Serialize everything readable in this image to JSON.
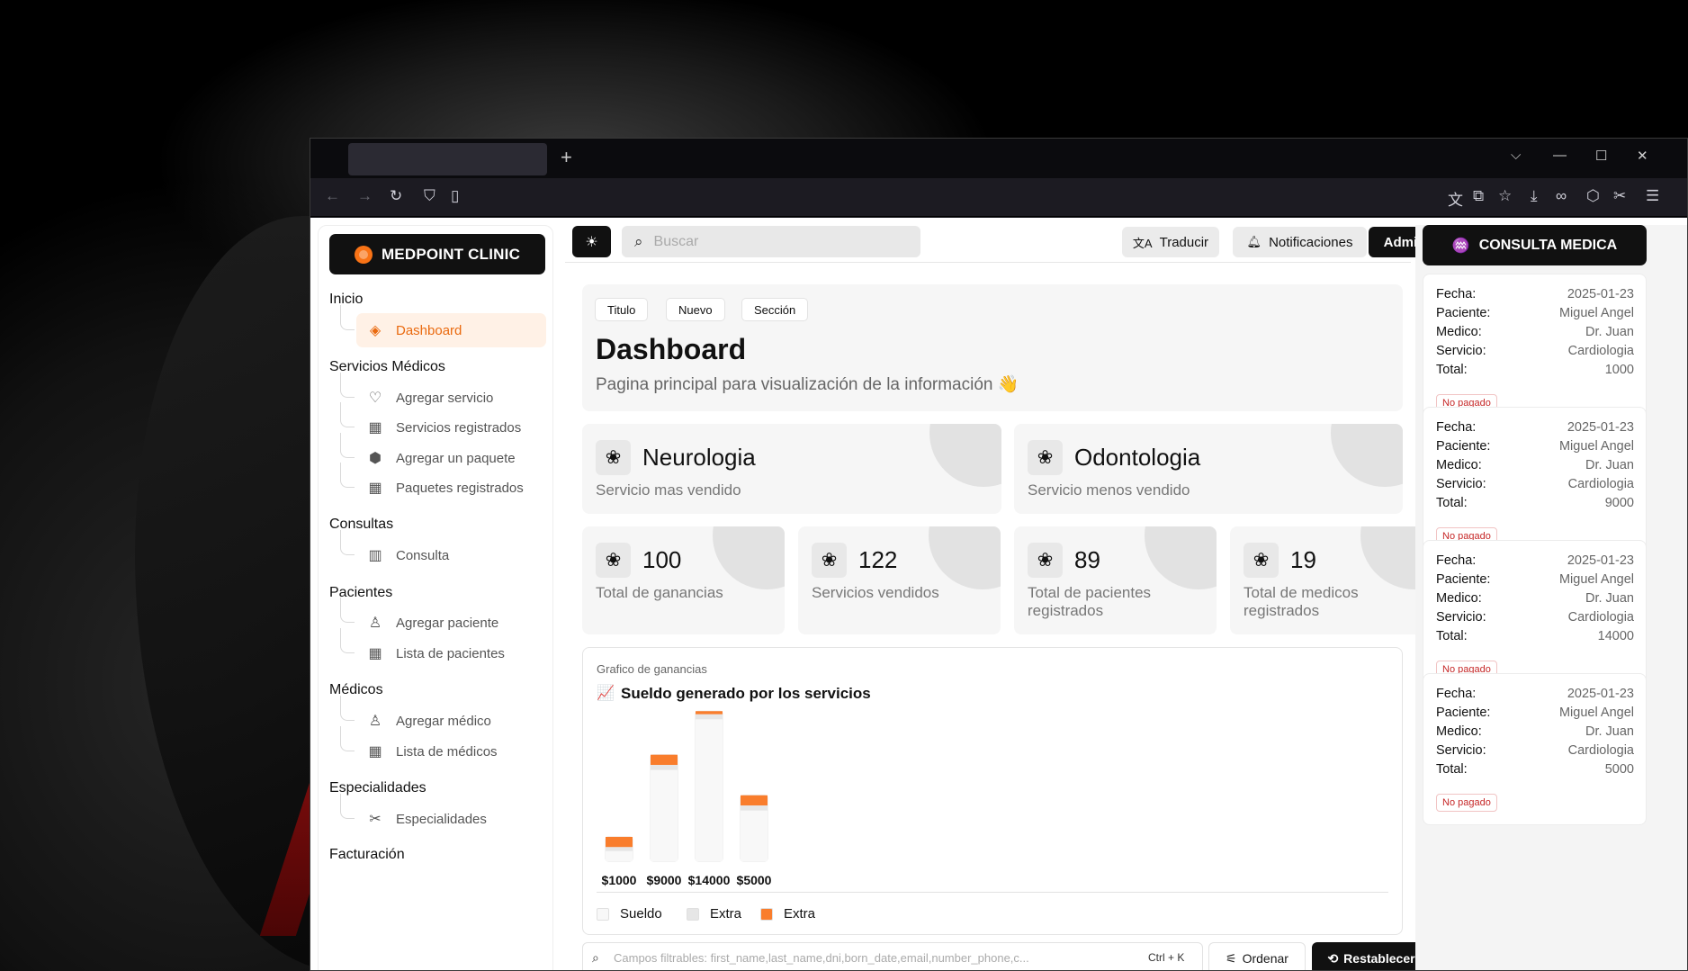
{
  "browser": {
    "new_tab_glyph": "+",
    "tab_list_glyph": "⌵",
    "minimize_glyph": "—",
    "maximize_glyph": "☐",
    "close_glyph": "✕"
  },
  "sidebar": {
    "brand": "MEDPOINT CLINIC",
    "sections": [
      {
        "title": "Inicio",
        "items": [
          {
            "label": "Dashboard",
            "icon": "layers-icon",
            "glyph": "◈",
            "active": true
          }
        ]
      },
      {
        "title": "Servicios Médicos",
        "items": [
          {
            "label": "Agregar servicio",
            "icon": "heart-hand-icon",
            "glyph": "♡"
          },
          {
            "label": "Servicios registrados",
            "icon": "grid-icon",
            "glyph": "▦"
          },
          {
            "label": "Agregar un paquete",
            "icon": "package-icon",
            "glyph": "⬢"
          },
          {
            "label": "Paquetes registrados",
            "icon": "grid-icon",
            "glyph": "▦"
          }
        ]
      },
      {
        "title": "Consultas",
        "items": [
          {
            "label": "Consulta",
            "icon": "building-icon",
            "glyph": "▥"
          }
        ]
      },
      {
        "title": "Pacientes",
        "items": [
          {
            "label": "Agregar paciente",
            "icon": "user-icon",
            "glyph": "♙"
          },
          {
            "label": "Lista de pacientes",
            "icon": "grid-icon",
            "glyph": "▦"
          }
        ]
      },
      {
        "title": "Médicos",
        "items": [
          {
            "label": "Agregar médico",
            "icon": "user-plus-icon",
            "glyph": "♙"
          },
          {
            "label": "Lista de médicos",
            "icon": "grid-icon",
            "glyph": "▦"
          }
        ]
      },
      {
        "title": "Especialidades",
        "items": [
          {
            "label": "Especialidades",
            "icon": "scissors-icon",
            "glyph": "✂"
          }
        ]
      },
      {
        "title": "Facturación",
        "items": []
      }
    ]
  },
  "topbar": {
    "search_placeholder": "Buscar",
    "translate_label": "Traducir",
    "notifications_label": "Notificaciones",
    "admin_label": "Admin"
  },
  "hero": {
    "chips": [
      "Titulo",
      "Nuevo",
      "Sección"
    ],
    "title": "Dashboard",
    "subtitle": "Pagina principal para visualización de la información 👋"
  },
  "highlights": [
    {
      "value": "Neurologia",
      "label": "Servicio mas vendido"
    },
    {
      "value": "Odontologia",
      "label": "Servicio menos vendido"
    }
  ],
  "stats": [
    {
      "value": "100",
      "label": "Total de ganancias"
    },
    {
      "value": "122",
      "label": "Servicios vendidos"
    },
    {
      "value": "89",
      "label": "Total de pacientes registrados"
    },
    {
      "value": "19",
      "label": "Total de medicos registrados"
    }
  ],
  "chart": {
    "caption": "Grafico de ganancias",
    "emoji": "📈",
    "title": "Sueldo generado por los servicios"
  },
  "chart_data": {
    "type": "bar",
    "categories": [
      "$1000",
      "$9000",
      "$14000",
      "$5000"
    ],
    "series": [
      {
        "name": "Sueldo",
        "values": [
          1000,
          9000,
          14000,
          5000
        ],
        "color": "#f8f8f8"
      },
      {
        "name": "Extra",
        "values": [
          400,
          500,
          500,
          500
        ],
        "color": "#e6e6e6"
      },
      {
        "name": "Extra",
        "values": [
          1000,
          1000,
          300,
          1000
        ],
        "color": "#f97d2c"
      }
    ],
    "stacked": true,
    "ylim": [
      0,
      15000
    ],
    "grid": false,
    "legend": "bottom-left"
  },
  "filter": {
    "placeholder": "Campos filtrables: first_name,last_name,dni,born_date,email,number_phone,c...",
    "shortcut": "Ctrl + K",
    "order_label": "Ordenar",
    "reset_label": "Restablecer"
  },
  "consultas_panel": {
    "title": "CONSULTA MEDICA",
    "labels": {
      "fecha": "Fecha:",
      "paciente": "Paciente:",
      "medico": "Medico:",
      "servicio": "Servicio:",
      "total": "Total:"
    },
    "items": [
      {
        "fecha": "2025-01-23",
        "paciente": "Miguel Angel",
        "medico": "Dr. Juan",
        "servicio": "Cardiologia",
        "total": "1000",
        "status": "No pagado"
      },
      {
        "fecha": "2025-01-23",
        "paciente": "Miguel Angel",
        "medico": "Dr. Juan",
        "servicio": "Cardiologia",
        "total": "9000",
        "status": "No pagado"
      },
      {
        "fecha": "2025-01-23",
        "paciente": "Miguel Angel",
        "medico": "Dr. Juan",
        "servicio": "Cardiologia",
        "total": "14000",
        "status": "No pagado"
      },
      {
        "fecha": "2025-01-23",
        "paciente": "Miguel Angel",
        "medico": "Dr. Juan",
        "servicio": "Cardiologia",
        "total": "5000",
        "status": "No pagado"
      }
    ]
  },
  "colors": {
    "accent": "#f97d2c",
    "dark": "#111111",
    "status_unpaid": "#c62828"
  }
}
